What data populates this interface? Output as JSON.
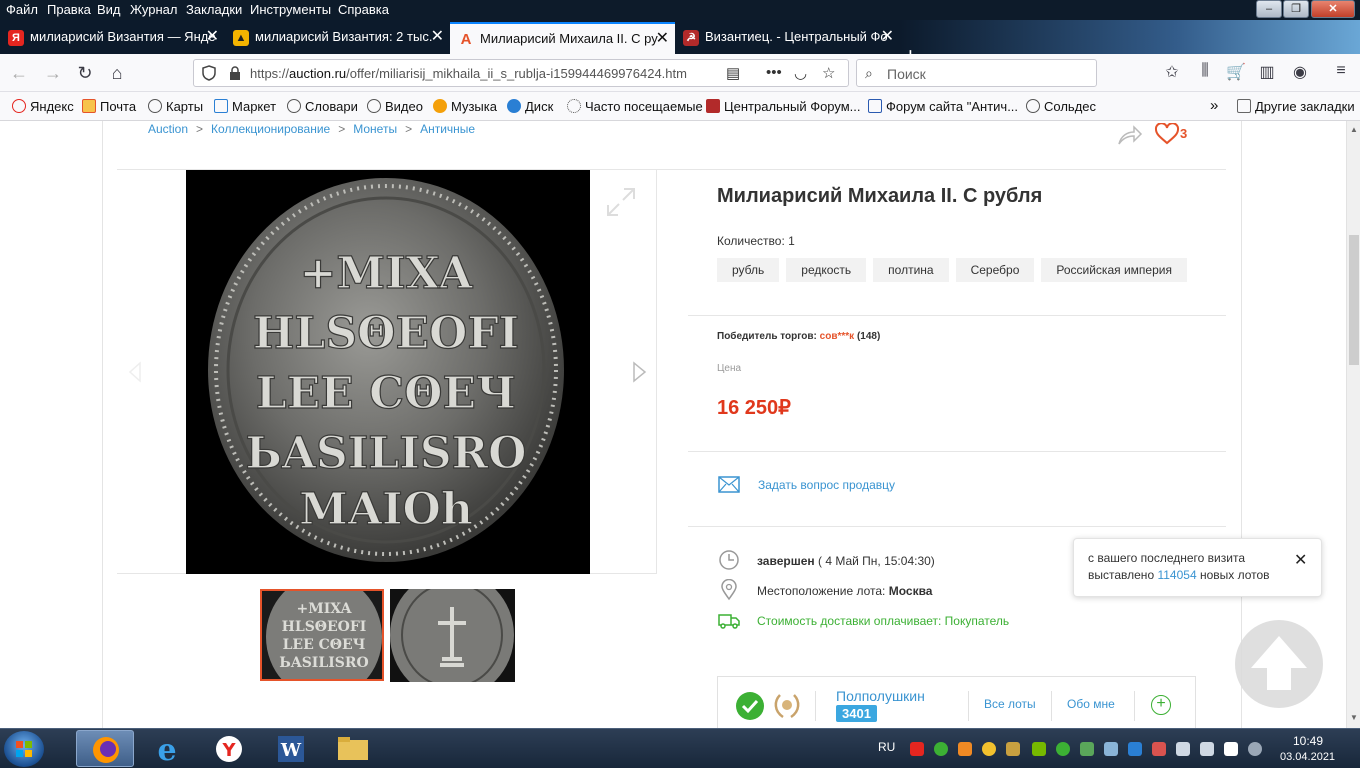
{
  "menu": [
    "Файл",
    "Правка",
    "Вид",
    "Журнал",
    "Закладки",
    "Инструменты",
    "Справка"
  ],
  "tabs": [
    {
      "label": "милиарисий Византия — Янде",
      "icon": "yandex-icon",
      "icon_color": "#e52620"
    },
    {
      "label": "милиарисий Византия: 2 тыс.",
      "icon": "image-search-icon",
      "icon_color": "#f4b400"
    },
    {
      "label": "Милиарисий Михаила II. С ру",
      "icon": "auction-icon",
      "icon_color": "#e5532a"
    },
    {
      "label": "Византиец. - Центральный Фо",
      "icon": "forum-icon",
      "icon_color": "#b22a2a"
    }
  ],
  "nav": {
    "url_prefix": "https://",
    "url_host": "auction.ru",
    "url_path": "/offer/miliarisij_mikhaila_ii_s_rublja-i159944469976424.htm",
    "search_placeholder": "Поиск"
  },
  "bookmarks": [
    {
      "label": "Яндекс",
      "icon": "yandex-icon"
    },
    {
      "label": "Почта",
      "icon": "mail-icon"
    },
    {
      "label": "Карты",
      "icon": "globe-icon"
    },
    {
      "label": "Маркет",
      "icon": "cart-icon"
    },
    {
      "label": "Словари",
      "icon": "globe-icon"
    },
    {
      "label": "Видео",
      "icon": "globe-icon"
    },
    {
      "label": "Музыка",
      "icon": "music-icon"
    },
    {
      "label": "Диск",
      "icon": "cloud-icon"
    },
    {
      "label": "Часто посещаемые",
      "icon": "gear-icon"
    },
    {
      "label": "Центральный Форум...",
      "icon": "forum-icon"
    },
    {
      "label": "Форум сайта \"Антич...",
      "icon": "forum-icon"
    },
    {
      "label": "Сольдес",
      "icon": "globe-icon"
    }
  ],
  "other_bookmarks": "Другие закладки",
  "breadcrumb": [
    "Auction",
    "Коллекционирование",
    "Монеты",
    "Античные"
  ],
  "likes_count": "3",
  "lot": {
    "title": "Милиарисий Михаила II. С рубля",
    "quantity": "Количество: 1",
    "tags": [
      "рубль",
      "редкость",
      "полтина",
      "Серебро",
      "Российская империя"
    ],
    "winner_label": "Победитель торгов:",
    "winner_nick": "сов***к",
    "winner_score": "(148)",
    "price_label": "Цена",
    "price": "16 250₽",
    "ask_seller": "Задать вопрос продавцу",
    "status_bold": "завершен",
    "status_rest": "( 4 Май Пн, 15:04:30)",
    "location_label": "Местоположение лота:",
    "location_value": "Москва",
    "delivery": "Стоимость доставки оплачивает: Покупатель"
  },
  "coin_inscription": [
    "+MIXA",
    "HLSΘEOFI",
    "LEE CΘEЧ",
    "ЬASILISRO",
    "MAIOh"
  ],
  "seller": {
    "name": "Полполушкин",
    "rating": "3401",
    "all_lots": "Все лоты",
    "about": "Обо мне"
  },
  "notice": {
    "line1": "с вашего последнего визита",
    "line2_prefix": "выставлено",
    "count": "114054",
    "line2_suffix": "новых лотов"
  },
  "taskbar": {
    "lang": "RU",
    "time": "10:49",
    "date": "03.04.2021"
  },
  "colors": {
    "accent_orange": "#e5532a",
    "link_blue": "#3a94d1",
    "price_red": "#e0381c",
    "green": "#3cb034"
  }
}
